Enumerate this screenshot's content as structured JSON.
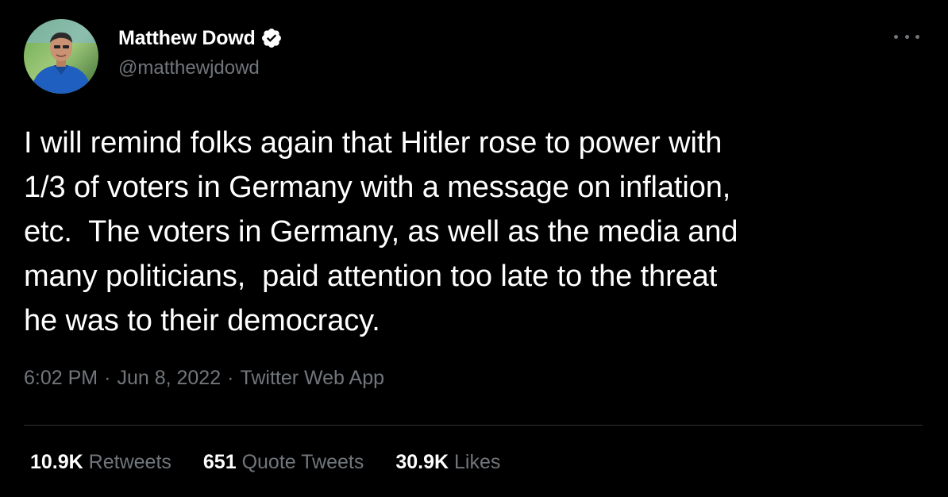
{
  "author": {
    "display_name": "Matthew Dowd",
    "handle": "@matthewjdowd",
    "verified_icon": "verified-badge-icon",
    "avatar_icon": "avatar"
  },
  "more_icon": "more-options-icon",
  "tweet": {
    "text": "I will remind folks again that Hitler rose to power with\n1/3 of voters in Germany with a message on inflation,\netc.  The voters in Germany, as well as the media and\nmany politicians,  paid attention too late to the threat\nhe was to their democracy."
  },
  "meta": {
    "time": "6:02 PM",
    "separator1": "·",
    "date": "Jun 8, 2022",
    "separator2": "·",
    "source": "Twitter Web App"
  },
  "stats": {
    "retweets_count": "10.9K",
    "retweets_label": "Retweets",
    "quotes_count": "651",
    "quotes_label": "Quote Tweets",
    "likes_count": "30.9K",
    "likes_label": "Likes"
  },
  "colors": {
    "background": "#000000",
    "text": "#ffffff",
    "muted": "#71767b",
    "divider": "#2f3336",
    "verified": "#ffffff"
  }
}
